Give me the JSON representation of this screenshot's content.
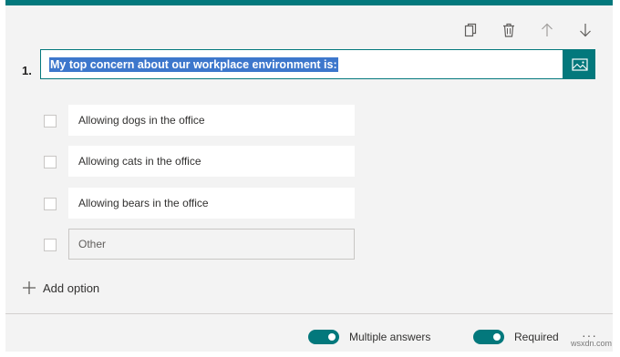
{
  "question": {
    "number": "1.",
    "title": "My top concern about our workplace environment is:"
  },
  "toolbar": {
    "icons": [
      "copy-icon",
      "trash-icon",
      "arrow-up-icon",
      "arrow-down-icon"
    ]
  },
  "options": [
    {
      "label": "Allowing dogs in the office",
      "checked": false
    },
    {
      "label": "Allowing cats in the office",
      "checked": false
    },
    {
      "label": "Allowing bears in the office",
      "checked": false
    }
  ],
  "other_option": {
    "placeholder": "Other",
    "checked": false
  },
  "add_option_label": "Add option",
  "footer": {
    "multiple_answers": {
      "label": "Multiple answers",
      "on": true
    },
    "required": {
      "label": "Required",
      "on": true
    },
    "more_label": "···"
  },
  "watermark": "wsxdn.com",
  "colors": {
    "accent": "#03787c",
    "selection": "#3d77cc",
    "background": "#f3f3f3"
  }
}
